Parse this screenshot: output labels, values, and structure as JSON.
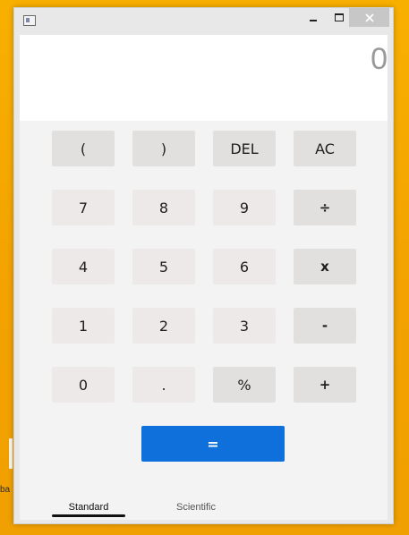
{
  "desktop": {
    "fragment_text": "ba"
  },
  "window": {
    "title": "",
    "controls": {
      "minimize": "minimize",
      "maximize": "maximize",
      "close": "close"
    }
  },
  "display": {
    "value": "0"
  },
  "keys": [
    {
      "label": "(",
      "kind": "func"
    },
    {
      "label": ")",
      "kind": "func"
    },
    {
      "label": "DEL",
      "kind": "func"
    },
    {
      "label": "AC",
      "kind": "func"
    },
    {
      "label": "7",
      "kind": "digit"
    },
    {
      "label": "8",
      "kind": "digit"
    },
    {
      "label": "9",
      "kind": "digit"
    },
    {
      "label": "÷",
      "kind": "op"
    },
    {
      "label": "4",
      "kind": "digit"
    },
    {
      "label": "5",
      "kind": "digit"
    },
    {
      "label": "6",
      "kind": "digit"
    },
    {
      "label": "x",
      "kind": "op"
    },
    {
      "label": "1",
      "kind": "digit"
    },
    {
      "label": "2",
      "kind": "digit"
    },
    {
      "label": "3",
      "kind": "digit"
    },
    {
      "label": "-",
      "kind": "op"
    },
    {
      "label": "0",
      "kind": "digit"
    },
    {
      "label": ".",
      "kind": "digit"
    },
    {
      "label": "%",
      "kind": "func"
    },
    {
      "label": "+",
      "kind": "op"
    }
  ],
  "equals": {
    "label": "="
  },
  "tabs": [
    {
      "label": "Standard",
      "active": true
    },
    {
      "label": "Scientific",
      "active": false
    }
  ],
  "colors": {
    "desktop": "#f5a600",
    "accent": "#0f6fdb",
    "display_text": "#9a9a9a"
  }
}
